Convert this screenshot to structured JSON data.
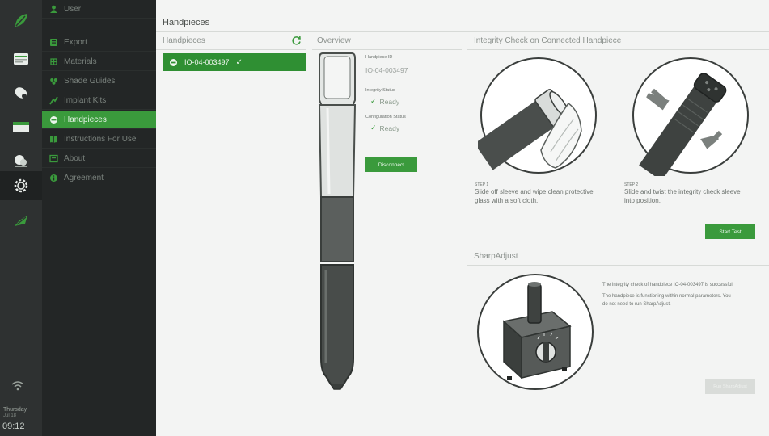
{
  "rail": {
    "status": {
      "day": "Thursday",
      "date": "Jul 18",
      "time": "09:12"
    }
  },
  "menu": {
    "items": [
      {
        "label": "User",
        "icon": "user-icon"
      },
      {
        "label": "Export",
        "icon": "export-icon"
      },
      {
        "label": "Materials",
        "icon": "materials-icon"
      },
      {
        "label": "Shade Guides",
        "icon": "shade-guides-icon"
      },
      {
        "label": "Implant Kits",
        "icon": "implant-kits-icon"
      },
      {
        "label": "Handpieces",
        "icon": "handpiece-icon",
        "active": true
      },
      {
        "label": "Instructions For Use",
        "icon": "book-icon"
      },
      {
        "label": "About",
        "icon": "about-icon"
      },
      {
        "label": "Agreement",
        "icon": "info-icon"
      }
    ]
  },
  "main": {
    "title": "Handpieces",
    "handpieces": {
      "title": "Handpieces",
      "items": [
        {
          "id": "IO-04-003497",
          "connected": true
        }
      ]
    },
    "overview": {
      "title": "Overview",
      "id_label": "Handpiece ID",
      "id_value": "IO-04-003497",
      "integrity_label": "Integrity Status",
      "integrity_value": "Ready",
      "config_label": "Configuration Status",
      "config_value": "Ready",
      "disconnect_label": "Disconnect"
    },
    "integrity": {
      "title": "Integrity Check on Connected Handpiece",
      "step1_num": "STEP 1",
      "step1_line1": "Slide off sleeve and wipe clean protective",
      "step1_line2": "glass with a soft cloth.",
      "step2_num": "STEP 2",
      "step2_line1": "Slide and twist the integrity check sleeve",
      "step2_line2": "into position.",
      "start_label": "Start Test"
    },
    "sharpadjust": {
      "title": "SharpAdjust",
      "line1": "The integrity check of handpiece IO-04-003497 is successful.",
      "line2": "The handpiece is functioning within normal parameters. You",
      "line3": "do not need to run SharpAdjust.",
      "run_label": "Run SharpAdjust"
    }
  },
  "colors": {
    "accent": "#3a9a3c",
    "rail": "#2e3131",
    "menu": "#232626",
    "background": "#f3f4f3"
  }
}
